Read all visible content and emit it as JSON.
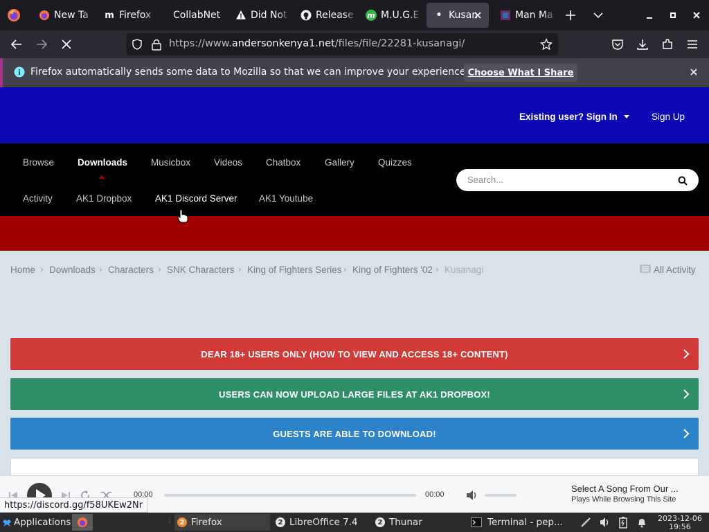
{
  "browser": {
    "tabs": [
      {
        "label": "New Ta",
        "icon": "firefox-icon"
      },
      {
        "label": "Firefox",
        "icon": "medium-icon"
      },
      {
        "label": "CollabNet",
        "icon": ""
      },
      {
        "label": "Did Not",
        "icon": "warning-icon"
      },
      {
        "label": "Release",
        "icon": "github-icon"
      },
      {
        "label": "M.U.G.E",
        "icon": "mugen-icon"
      },
      {
        "label": "Kusan",
        "icon": "dot-icon"
      },
      {
        "label": "Man Ma",
        "icon": "site-icon"
      }
    ],
    "url_prefix": "https://www.",
    "url_domain": "andersonkenya1.net",
    "url_path": "/files/file/22281-kusanagi/",
    "notification_text": "Firefox automatically sends some data to Mozilla so that we can improve your experience.",
    "notification_button": "Choose What I Share",
    "status_link": "https://discord.gg/f58UKEw2Nr"
  },
  "site": {
    "colors": {
      "header_blue": "#0c09b4",
      "header_red": "#a00000",
      "banner_red": "#d23a37",
      "banner_green": "#2e8f66",
      "banner_blue": "#2d83c9"
    },
    "sign_in": "Existing user? Sign In",
    "sign_up": "Sign Up",
    "nav_row1": [
      "Browse",
      "Downloads",
      "Musicbox",
      "Videos",
      "Chatbox",
      "Gallery",
      "Quizzes"
    ],
    "nav_row2": [
      "Activity",
      "AK1 Dropbox",
      "AK1 Discord Server",
      "AK1 Youtube"
    ],
    "active_nav": "Downloads",
    "search_placeholder": "Search...",
    "breadcrumbs": [
      "Home",
      "Downloads",
      "Characters",
      "SNK Characters",
      "King of Fighters Series",
      "King of Fighters '02",
      "Kusanagi"
    ],
    "all_activity": "All Activity",
    "banners": [
      "DEAR 18+ USERS ONLY (HOW TO VIEW AND ACCESS 18+ CONTENT)",
      "USERS CAN NOW UPLOAD LARGE FILES AT AK1 DROPBOX!",
      "GUESTS ARE ABLE TO DOWNLOAD!"
    ]
  },
  "player": {
    "time_current": "00:00",
    "time_total": "00:00",
    "song_title": "Select A Song From Our ...",
    "song_subtitle": "Plays While Browsing This Site"
  },
  "taskbar": {
    "applications": "Applications",
    "tasks": [
      {
        "label": "Firefox",
        "count": "2"
      },
      {
        "label": "LibreOffice 7.4",
        "count": "2"
      },
      {
        "label": "Thunar",
        "count": "2"
      },
      {
        "label": "Terminal - pep...",
        "count": ""
      }
    ],
    "date": "2023-12-06",
    "time": "19:56"
  }
}
